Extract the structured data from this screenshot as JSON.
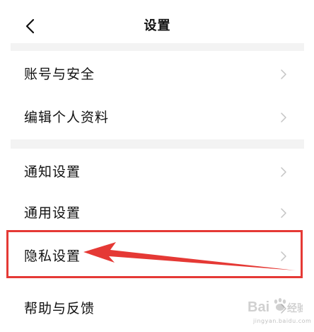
{
  "header": {
    "title": "设置",
    "back_icon": "chevron-left-icon"
  },
  "groups": [
    {
      "items": [
        {
          "label": "账号与安全",
          "icon": "chevron-right-icon"
        },
        {
          "label": "编辑个人资料",
          "icon": "chevron-right-icon"
        }
      ]
    },
    {
      "items": [
        {
          "label": "通知设置",
          "icon": "chevron-right-icon"
        },
        {
          "label": "通用设置",
          "icon": "chevron-right-icon"
        },
        {
          "label": "隐私设置",
          "icon": "chevron-right-icon",
          "highlighted": true
        },
        {
          "label": "帮助与反馈",
          "icon": "chevron-right-icon"
        }
      ]
    }
  ],
  "annotation": {
    "highlight_color": "#e53935",
    "arrow_color": "#e53935"
  },
  "watermark": {
    "brand": "Baidu",
    "text": "经验",
    "url": "jingyan.baidu.com"
  }
}
